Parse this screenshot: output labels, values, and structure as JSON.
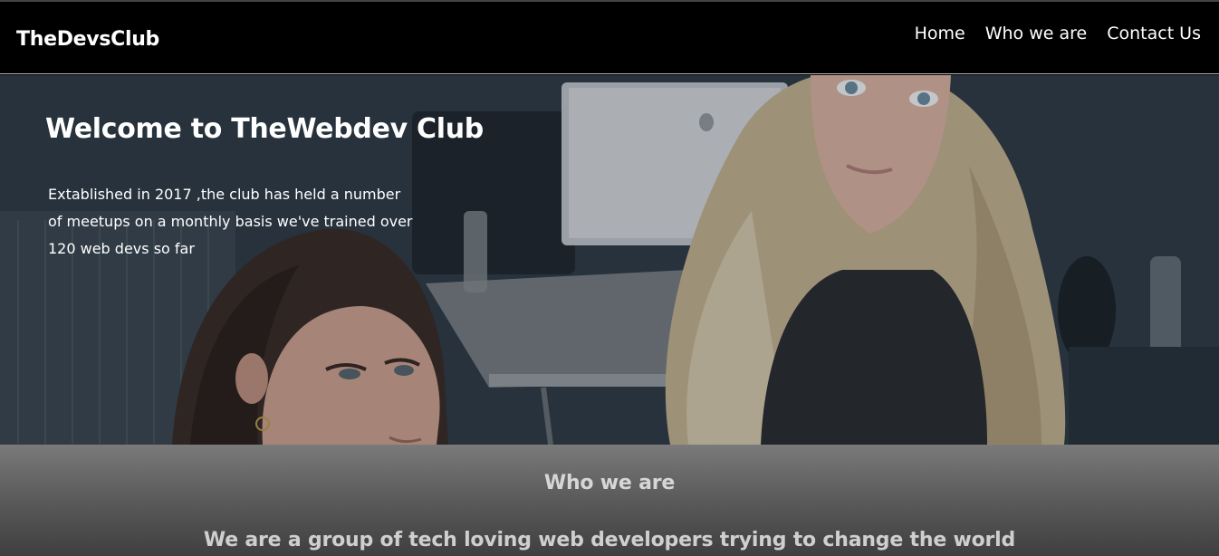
{
  "navbar": {
    "brand": "TheDevsClub",
    "links": [
      {
        "label": "Home"
      },
      {
        "label": "Who we are"
      },
      {
        "label": "Contact Us"
      }
    ]
  },
  "hero": {
    "title": "Welcome to TheWebdev Club",
    "text_lines": [
      "Extablished in 2017 ,the club has held a number",
      "of meetups on a monthly basis we've trained over",
      "120 web devs so far"
    ],
    "image": "photo-two-women-at-laptop"
  },
  "about": {
    "heading": "Who we are",
    "text": "We are a group of tech loving web developers trying to change the world"
  },
  "colors": {
    "navbar_bg": "#000000",
    "text": "#ffffff",
    "section_bg": "#6b6b6b"
  }
}
